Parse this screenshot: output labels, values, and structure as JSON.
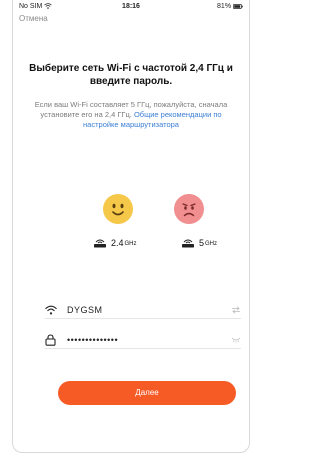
{
  "status_bar": {
    "carrier": "No SIM",
    "time": "18:16",
    "battery": "81%"
  },
  "nav": {
    "cancel_label": "Отмена"
  },
  "heading": {
    "title": "Выберите сеть Wi-Fi с частотой 2,4 ГГц и введите пароль."
  },
  "note": {
    "text": "Если ваш Wi-Fi составляет 5 ГГц, пожалуйста, сначала установите его на 2,4 ГГц.",
    "link": "Общие рекомендации по настройке маршрутизатора"
  },
  "bands": [
    {
      "value": "2.4",
      "unit": "GHz",
      "status": "supported",
      "icon": "happy-face-icon"
    },
    {
      "value": "5",
      "unit": "GHz",
      "status": "unsupported",
      "icon": "sad-face-icon"
    }
  ],
  "form": {
    "ssid_value": "DYGSM",
    "password_value": "••••••••••••••"
  },
  "actions": {
    "next_label": "Далее"
  },
  "colors": {
    "accent": "#f65a25",
    "link": "#3b7ed6",
    "happy_face": "#f6c84a",
    "sad_face": "#f08e90"
  }
}
